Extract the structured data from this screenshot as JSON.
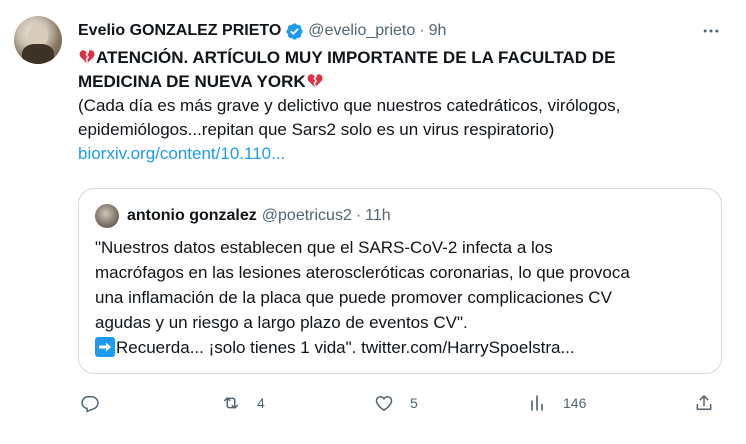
{
  "tweet": {
    "author": {
      "display_name": "Evelio GONZALEZ PRIETO",
      "handle": "@evelio_prieto",
      "time": "9h"
    },
    "text": {
      "line1": "ATENCIÓN. ARTÍCULO MUY IMPORTANTE DE LA FACULTAD DE",
      "line2": "MEDICINA DE NUEVA YORK",
      "line3": "(Cada día es más grave y delictivo que nuestros catedráticos, virólogos,",
      "line4": "epidemiólogos...repitan que Sars2 solo es un virus respiratorio)",
      "link": "biorxiv.org/content/10.110..."
    },
    "quote": {
      "display_name": "antonio gonzalez",
      "handle": "@poetricus2",
      "time": "11h",
      "lines": [
        "\"Nuestros datos establecen que el SARS-CoV-2 infecta a los",
        "macrófagos en las lesiones ateroscleróticas coronarias, lo que provoca",
        "una inflamación de la placa que puede promover complicaciones CV",
        "agudas y un riesgo a largo plazo de eventos CV\"."
      ],
      "last_line": "Recuerda... ¡solo tienes 1 vida\". twitter.com/HarrySpoelstra..."
    },
    "actions": {
      "reply_count": "",
      "retweet_count": "4",
      "like_count": "5",
      "views_count": "146"
    },
    "colors": {
      "accent": "#1d9bf0",
      "text": "#0f1419",
      "secondary": "#536471",
      "heart_emoji": "#dd2e44"
    },
    "icons": [
      "verified-badge-icon",
      "more-icon",
      "broken-heart-icon",
      "arrow-right-emoji-icon",
      "reply-icon",
      "retweet-icon",
      "like-icon",
      "views-icon",
      "share-icon"
    ]
  }
}
